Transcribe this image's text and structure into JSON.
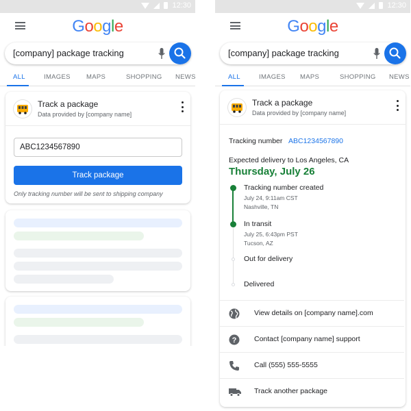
{
  "status_time": "12:30",
  "logo": [
    "G",
    "o",
    "o",
    "g",
    "l",
    "e"
  ],
  "search": {
    "query": "[company] package tracking"
  },
  "tabs": [
    "ALL",
    "IMAGES",
    "MAPS",
    "SHOPPING",
    "NEWS"
  ],
  "card_header": {
    "title": "Track a package",
    "subtitle": "Data provided by [company name]"
  },
  "left": {
    "tracking_input": "ABC1234567890",
    "track_button": "Track package",
    "note": "Only tracking number will be sent to shipping company"
  },
  "right": {
    "tracking_label": "Tracking number",
    "tracking_number": "ABC1234567890",
    "expected": "Expected delivery to Los Angeles, CA",
    "date": "Thursday, July 26",
    "events": [
      {
        "title": "Tracking number created",
        "time": "July 24, 9:11am CST",
        "place": "Nashville, TN",
        "done": true
      },
      {
        "title": "In transit",
        "time": "July 25, 6:43pm PST",
        "place": "Tucson, AZ",
        "done": true
      },
      {
        "title": "Out for delivery",
        "done": false
      },
      {
        "title": "Delivered",
        "done": false
      }
    ],
    "actions": [
      {
        "label": "View details on [company name].com",
        "icon": "globe-icon"
      },
      {
        "label": "Contact [company name] support",
        "icon": "help-circle-icon"
      },
      {
        "label": "Call (555) 555-5555",
        "icon": "phone-icon"
      },
      {
        "label": "Track another package",
        "icon": "truck-icon"
      }
    ]
  },
  "colors": {
    "accent": "#1a73e8",
    "success": "#188038",
    "status_bar": "#e4e4e4",
    "skeleton_grey": "#eef0f3",
    "skeleton_blue": "#e8f0fe",
    "skeleton_green": "#eaf5ea"
  }
}
